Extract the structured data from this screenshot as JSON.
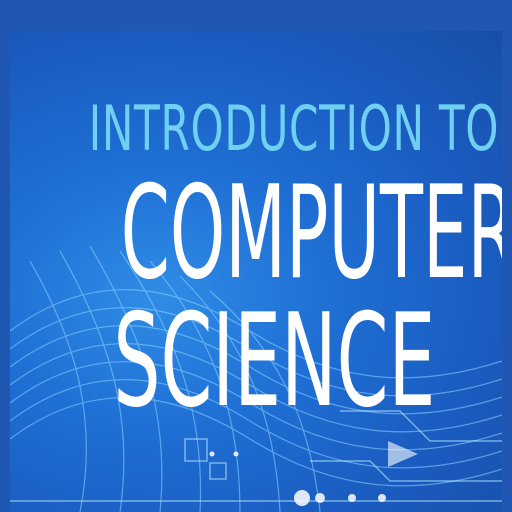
{
  "cover": {
    "title_line_1": "INTRODUCTION TO",
    "title_line_2": "COMPUTER",
    "title_line_3": "SCIENCE"
  },
  "colors": {
    "frame": "#1f57b3",
    "background": "#1a5bbf",
    "accent_text": "#6fd0f2",
    "main_text": "#ffffff",
    "graphic_lines": "#8fd6ff"
  }
}
